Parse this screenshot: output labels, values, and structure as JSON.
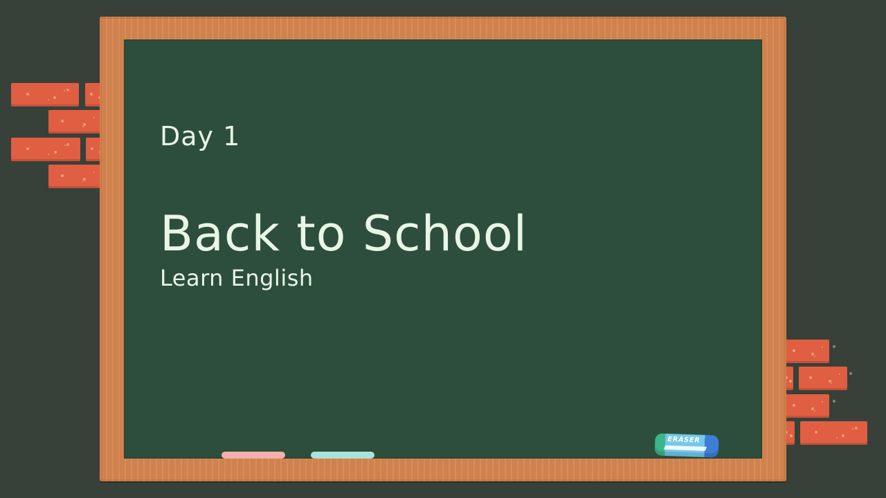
{
  "slide": {
    "day_label": "Day 1",
    "title": "Back to School",
    "subtitle": "Learn English"
  },
  "eraser": {
    "label": "ERASER"
  },
  "colors": {
    "background": "#374139",
    "board": "#2d4e3c",
    "frame": "#d6864f",
    "brick": "#e05e42",
    "chalk_text": "#e9f6e6",
    "chalk_pink": "#f2b0ae",
    "chalk_blue": "#a9e3dc"
  }
}
